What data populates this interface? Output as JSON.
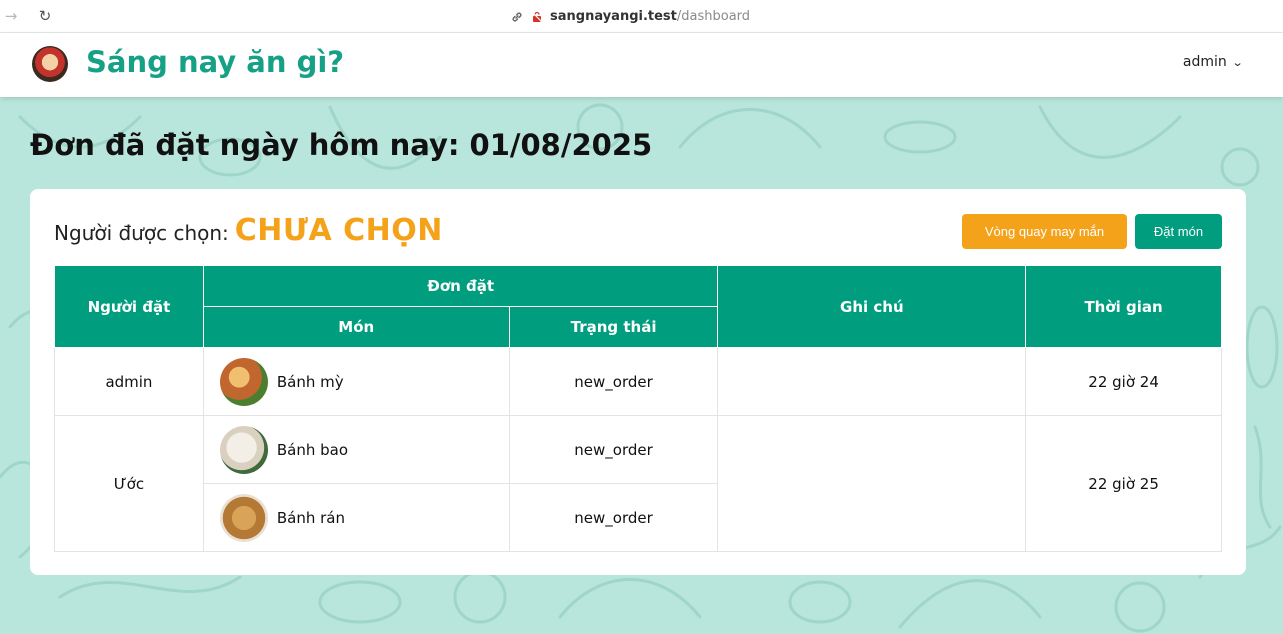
{
  "browser": {
    "host": "sangnayangi.test",
    "path": "/dashboard"
  },
  "header": {
    "app_title": "Sáng nay ăn gì?",
    "user": "admin"
  },
  "page": {
    "title": "Đơn đã đặt ngày hôm nay: 01/08/2025"
  },
  "card": {
    "chosen_label": "Người được chọn:",
    "chosen_value": "CHƯA CHỌN",
    "spin_button": "Vòng quay may mắn",
    "order_button": "Đặt món"
  },
  "table": {
    "headers": {
      "orderer": "Người đặt",
      "order_group": "Đơn đặt",
      "dish": "Món",
      "status": "Trạng thái",
      "note": "Ghi chú",
      "time": "Thời gian"
    },
    "rows": [
      {
        "orderer": "admin",
        "note": "",
        "time": "22 giờ 24",
        "items": [
          {
            "dish": "Bánh mỳ",
            "status": "new_order"
          }
        ]
      },
      {
        "orderer": "Ước",
        "note": "",
        "time": "22 giờ 25",
        "items": [
          {
            "dish": "Bánh bao",
            "status": "new_order"
          },
          {
            "dish": "Bánh rán",
            "status": "new_order"
          }
        ]
      }
    ]
  },
  "colors": {
    "brand": "#16a085",
    "table_header": "#009e7f",
    "accent": "#f5a21b",
    "background": "#b9e6dc"
  }
}
